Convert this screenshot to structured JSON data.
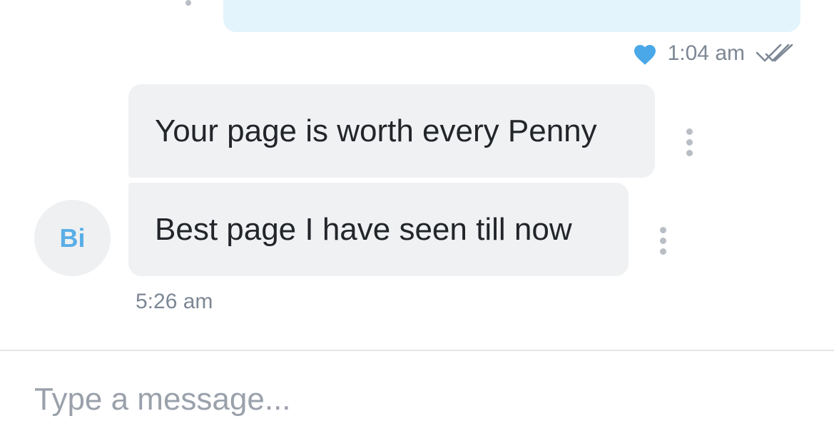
{
  "conversation": {
    "outgoing": {
      "time": "1:04 am",
      "liked": true,
      "status": "read"
    },
    "incoming": {
      "sender_initials": "Bi",
      "messages": [
        {
          "text": "Your page is worth every Penny"
        },
        {
          "text": "Best page I have seen till now"
        }
      ],
      "time": "5:26 am"
    }
  },
  "composer": {
    "placeholder": "Type a message..."
  },
  "colors": {
    "outgoing_bubble": "#e3f4fc",
    "incoming_bubble": "#f0f1f3",
    "accent": "#5aaee6",
    "heart": "#4aa8e8",
    "meta_text": "#7d8794"
  },
  "icons": {
    "like": "heart-icon",
    "read_receipt": "double-check-icon",
    "message_menu": "more-vertical-icon"
  }
}
